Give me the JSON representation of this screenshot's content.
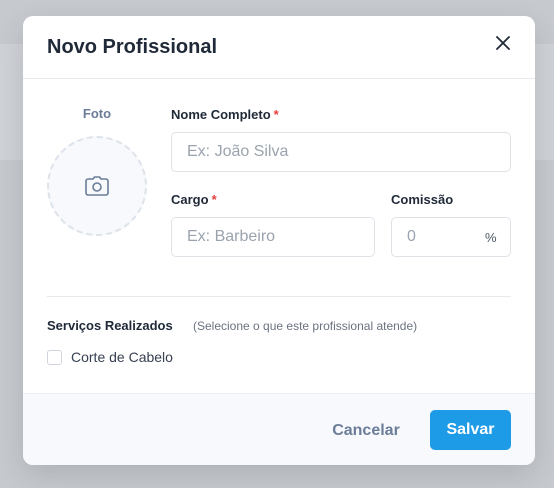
{
  "modal": {
    "title": "Novo Profissional"
  },
  "photo": {
    "label": "Foto"
  },
  "fields": {
    "name": {
      "label": "Nome Completo",
      "required_mark": "*",
      "placeholder": "Ex: João Silva",
      "value": ""
    },
    "role": {
      "label": "Cargo",
      "required_mark": "*",
      "placeholder": "Ex: Barbeiro",
      "value": ""
    },
    "commission": {
      "label": "Comissão",
      "placeholder": "0",
      "value": "",
      "suffix": "%"
    }
  },
  "services": {
    "title": "Serviços Realizados",
    "hint": "(Selecione o que este profissional atende)",
    "items": [
      {
        "label": "Corte de Cabelo",
        "checked": false
      }
    ]
  },
  "footer": {
    "cancel_label": "Cancelar",
    "save_label": "Salvar"
  },
  "colors": {
    "accent": "#1e9be6",
    "required": "#e53e3e",
    "overlay": "#c6c9ce"
  },
  "icons": {
    "close": "close-icon",
    "photo": "camera-icon"
  }
}
